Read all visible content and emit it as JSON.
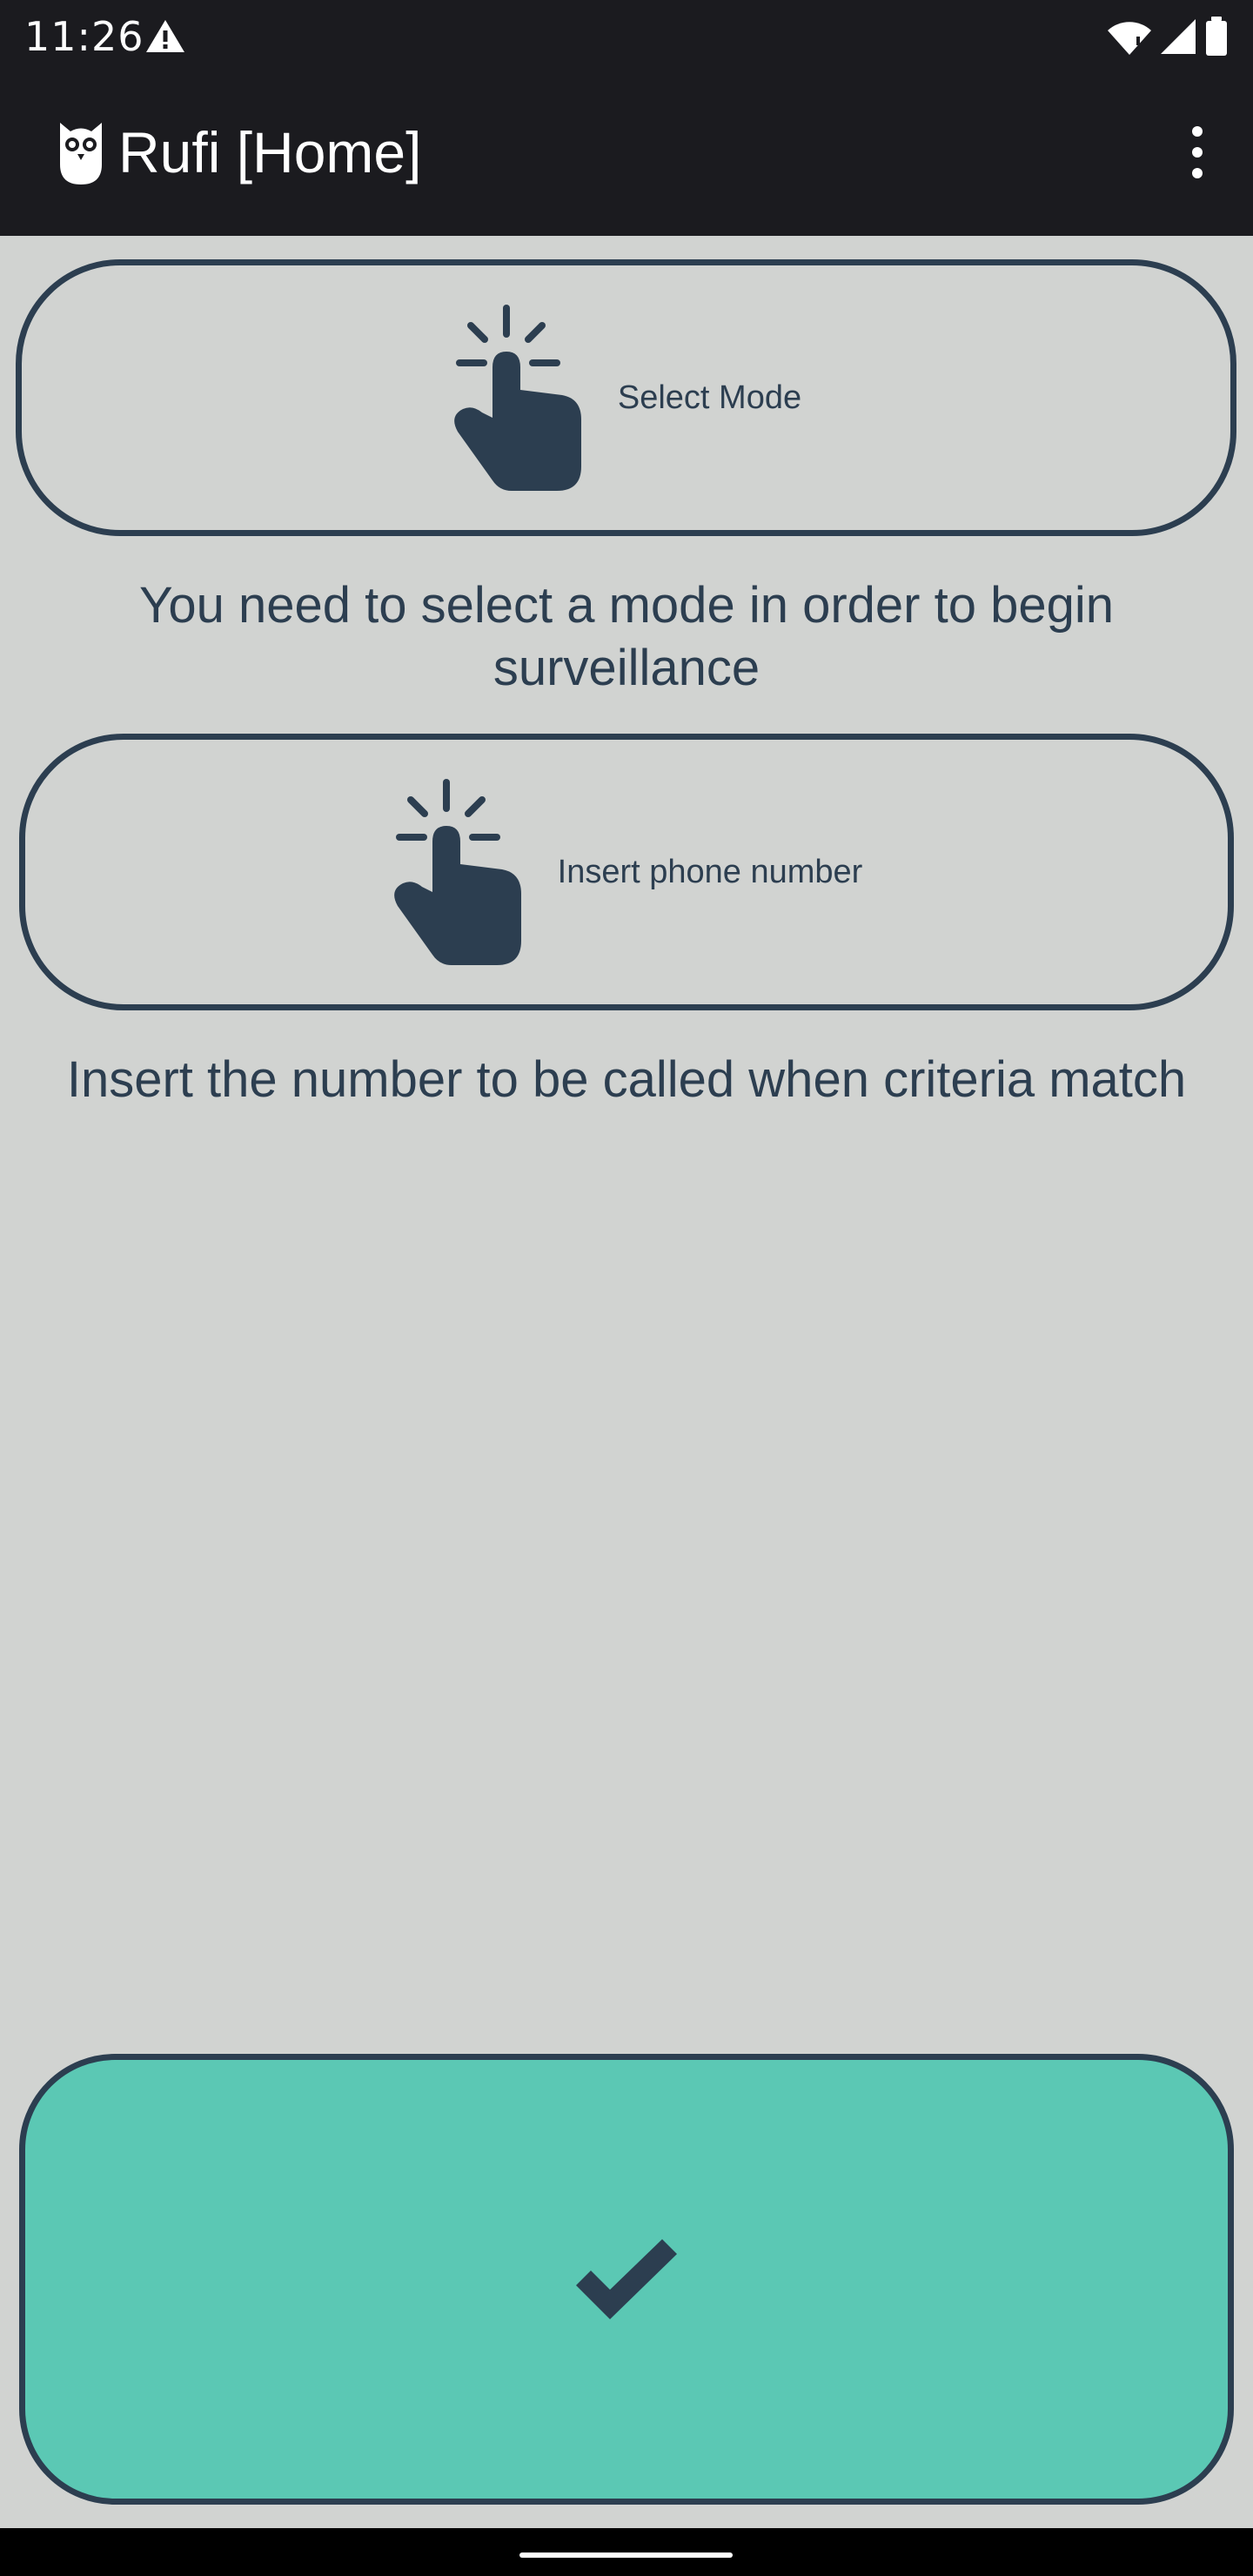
{
  "status_bar": {
    "time": "11:26",
    "icons": [
      "warning-icon",
      "wifi-icon",
      "signal-icon",
      "battery-icon"
    ]
  },
  "app_bar": {
    "title": "Rufi [Home]",
    "logo": "owl-icon",
    "menu_icon": "more-vertical-icon"
  },
  "mode": {
    "button_label": "Select Mode",
    "icon": "hand-pointer-icon",
    "help_text": "You need to select a mode in order to begin surveillance"
  },
  "phone": {
    "button_label": "Insert phone number",
    "icon": "hand-pointer-icon",
    "help_text": "Insert the number to be called when criteria match"
  },
  "confirm": {
    "icon": "check-icon",
    "color": "#5bc8b4"
  },
  "colors": {
    "background": "#d1d3d1",
    "app_bar": "#1b1b1f",
    "primary_text": "#2c3e50",
    "accent": "#5bc8b4"
  }
}
